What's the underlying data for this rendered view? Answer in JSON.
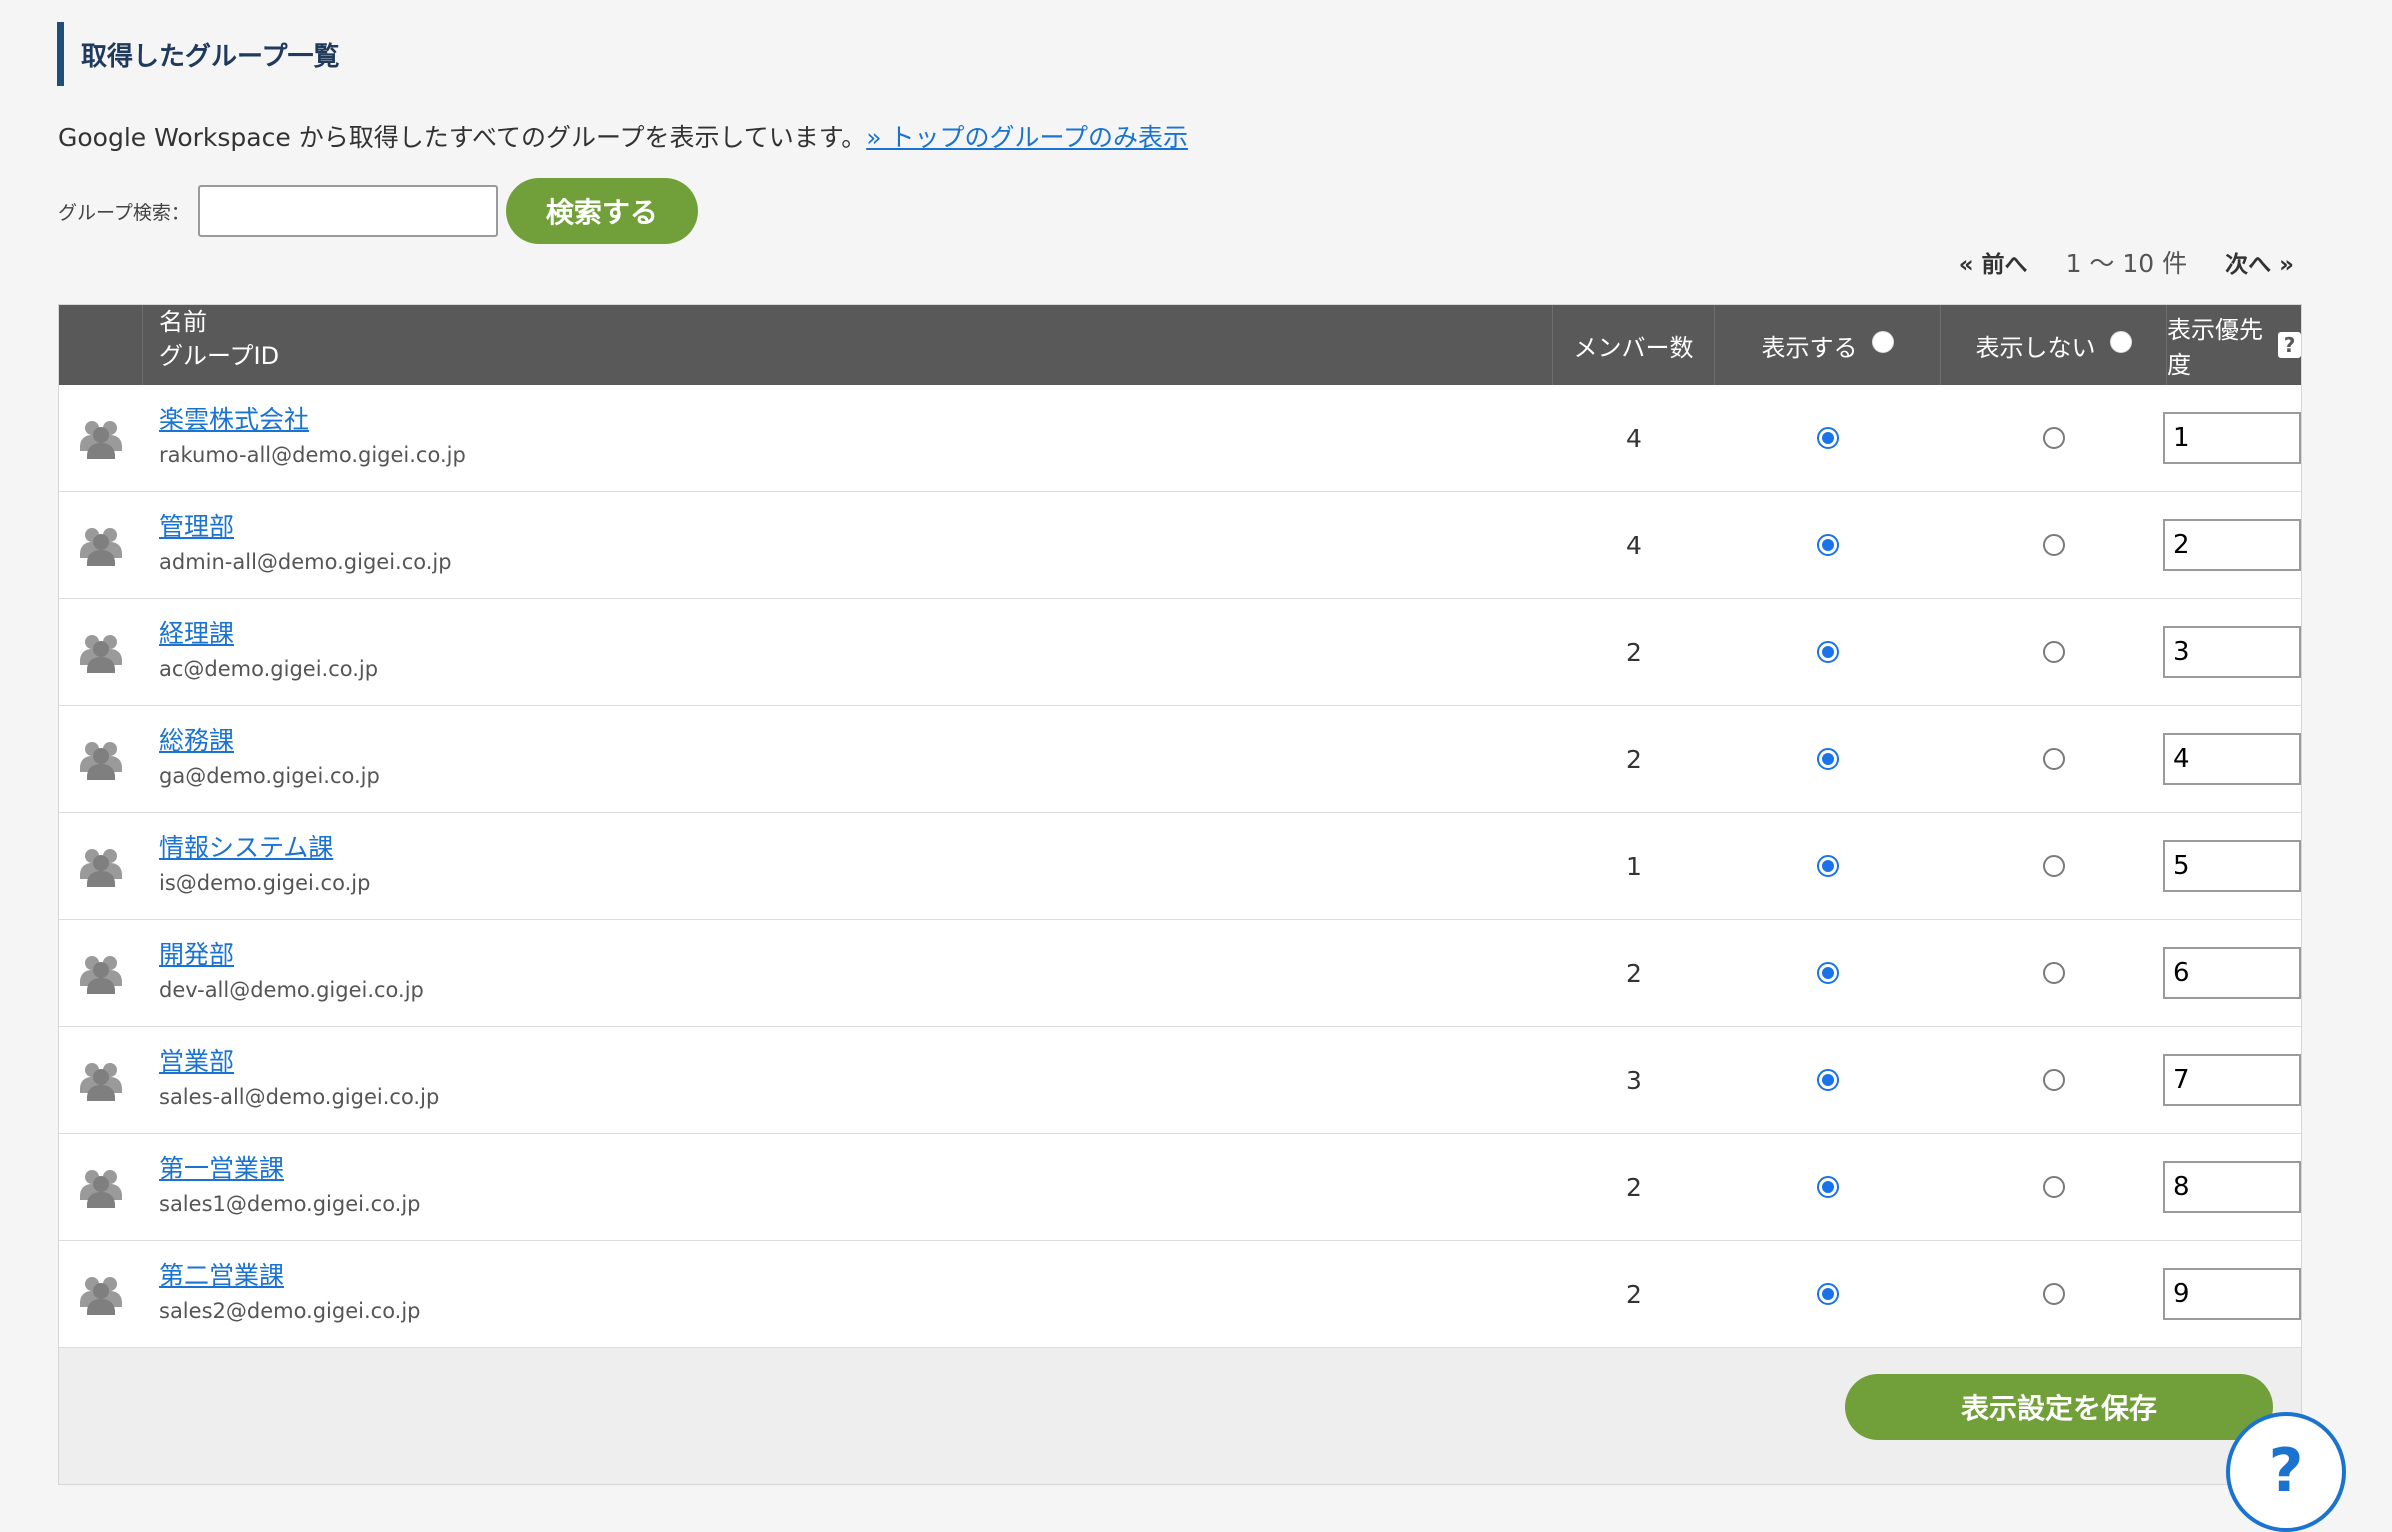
{
  "section": {
    "title": "取得したグループ一覧"
  },
  "description": {
    "text": "Google Workspace から取得したすべてのグループを表示しています。",
    "link": "» トップのグループのみ表示"
  },
  "search": {
    "label": "グループ検索：",
    "value": "",
    "button": "検索する"
  },
  "pager": {
    "prev": "« 前へ",
    "range": "1 〜 10 件",
    "next": "次へ »"
  },
  "table": {
    "headers": {
      "name": "名前",
      "group_id": "グループID",
      "members": "メンバー数",
      "show": "表示する",
      "hide": "表示しない",
      "priority": "表示優先度",
      "help": "?"
    },
    "rows": [
      {
        "name": "楽雲株式会社",
        "id": "rakumo-all@demo.gigei.co.jp",
        "members": "4",
        "show": true,
        "priority": "1"
      },
      {
        "name": "管理部",
        "id": "admin-all@demo.gigei.co.jp",
        "members": "4",
        "show": true,
        "priority": "2"
      },
      {
        "name": "経理課",
        "id": "ac@demo.gigei.co.jp",
        "members": "2",
        "show": true,
        "priority": "3"
      },
      {
        "name": "総務課",
        "id": "ga@demo.gigei.co.jp",
        "members": "2",
        "show": true,
        "priority": "4"
      },
      {
        "name": "情報システム課",
        "id": "is@demo.gigei.co.jp",
        "members": "1",
        "show": true,
        "priority": "5"
      },
      {
        "name": "開発部",
        "id": "dev-all@demo.gigei.co.jp",
        "members": "2",
        "show": true,
        "priority": "6"
      },
      {
        "name": "営業部",
        "id": "sales-all@demo.gigei.co.jp",
        "members": "3",
        "show": true,
        "priority": "7"
      },
      {
        "name": "第一営業課",
        "id": "sales1@demo.gigei.co.jp",
        "members": "2",
        "show": true,
        "priority": "8"
      },
      {
        "name": "第二営業課",
        "id": "sales2@demo.gigei.co.jp",
        "members": "2",
        "show": true,
        "priority": "9"
      }
    ]
  },
  "footer": {
    "save_button": "表示設定を保存"
  },
  "help_circle": {
    "label": "?"
  },
  "colors": {
    "accent_green": "#71a03a",
    "header_bg": "#595959",
    "link_blue": "#1a73d1",
    "title_bar": "#1f4e79"
  }
}
